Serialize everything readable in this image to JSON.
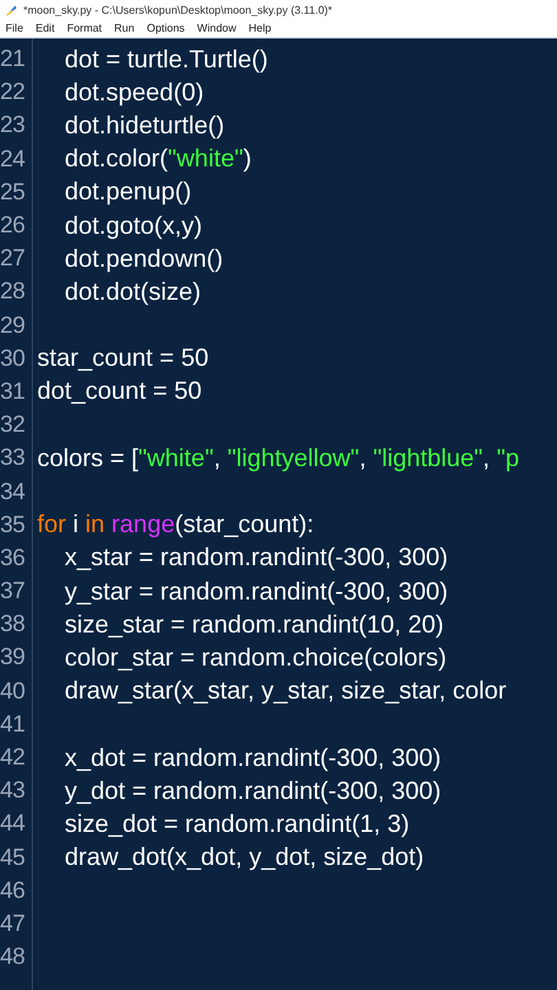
{
  "window": {
    "title": "*moon_sky.py - C:\\Users\\kopun\\Desktop\\moon_sky.py (3.11.0)*"
  },
  "menu": [
    {
      "label": "File"
    },
    {
      "label": "Edit"
    },
    {
      "label": "Format"
    },
    {
      "label": "Run"
    },
    {
      "label": "Options"
    },
    {
      "label": "Window"
    },
    {
      "label": "Help"
    }
  ],
  "editor": {
    "lines": [
      {
        "number": "21",
        "tokens": [
          {
            "kind": "plain",
            "text": "    dot = turtle.Turtle()"
          }
        ]
      },
      {
        "number": "22",
        "tokens": [
          {
            "kind": "plain",
            "text": "    dot.speed(0)"
          }
        ]
      },
      {
        "number": "23",
        "tokens": [
          {
            "kind": "plain",
            "text": "    dot.hideturtle()"
          }
        ]
      },
      {
        "number": "24",
        "tokens": [
          {
            "kind": "plain",
            "text": "    dot.color("
          },
          {
            "kind": "string",
            "text": "\"white\""
          },
          {
            "kind": "plain",
            "text": ")"
          }
        ]
      },
      {
        "number": "25",
        "tokens": [
          {
            "kind": "plain",
            "text": "    dot.penup()"
          }
        ]
      },
      {
        "number": "26",
        "tokens": [
          {
            "kind": "plain",
            "text": "    dot.goto(x,y)"
          }
        ]
      },
      {
        "number": "27",
        "tokens": [
          {
            "kind": "plain",
            "text": "    dot.pendown()"
          }
        ]
      },
      {
        "number": "28",
        "tokens": [
          {
            "kind": "plain",
            "text": "    dot.dot(size)"
          }
        ]
      },
      {
        "number": "29"
      },
      {
        "number": "30",
        "tokens": [
          {
            "kind": "plain",
            "text": "star_count = 50"
          }
        ]
      },
      {
        "number": "31",
        "tokens": [
          {
            "kind": "plain",
            "text": "dot_count = 50"
          }
        ]
      },
      {
        "number": "32"
      },
      {
        "number": "33",
        "tokens": [
          {
            "kind": "plain",
            "text": "colors = ["
          },
          {
            "kind": "string",
            "text": "\"white\""
          },
          {
            "kind": "plain",
            "text": ", "
          },
          {
            "kind": "string",
            "text": "\"lightyellow\""
          },
          {
            "kind": "plain",
            "text": ", "
          },
          {
            "kind": "string",
            "text": "\"lightblue\""
          },
          {
            "kind": "plain",
            "text": ", "
          },
          {
            "kind": "string",
            "text": "\"p"
          }
        ]
      },
      {
        "number": "34"
      },
      {
        "number": "35",
        "tokens": [
          {
            "kind": "keyword",
            "text": "for"
          },
          {
            "kind": "plain",
            "text": " i "
          },
          {
            "kind": "keyword",
            "text": "in "
          },
          {
            "kind": "builtin",
            "text": "range"
          },
          {
            "kind": "plain",
            "text": "(star_count):"
          }
        ]
      },
      {
        "number": "36",
        "tokens": [
          {
            "kind": "plain",
            "text": "    x_star = random.randint(-300, 300)"
          }
        ]
      },
      {
        "number": "37",
        "tokens": [
          {
            "kind": "plain",
            "text": "    y_star = random.randint(-300, 300)"
          }
        ]
      },
      {
        "number": "38",
        "tokens": [
          {
            "kind": "plain",
            "text": "    size_star = random.randint(10, 20)"
          }
        ]
      },
      {
        "number": "39",
        "tokens": [
          {
            "kind": "plain",
            "text": "    color_star = random.choice(colors)"
          }
        ]
      },
      {
        "number": "40",
        "tokens": [
          {
            "kind": "plain",
            "text": "    draw_star(x_star, y_star, size_star, color"
          }
        ]
      },
      {
        "number": "41"
      },
      {
        "number": "42",
        "tokens": [
          {
            "kind": "plain",
            "text": "    x_dot = random.randint(-300, 300)"
          }
        ]
      },
      {
        "number": "43",
        "tokens": [
          {
            "kind": "plain",
            "text": "    y_dot = random.randint(-300, 300)"
          }
        ]
      },
      {
        "number": "44",
        "tokens": [
          {
            "kind": "plain",
            "text": "    size_dot = random.randint(1, 3)"
          }
        ]
      },
      {
        "number": "45",
        "tokens": [
          {
            "kind": "plain",
            "text": "    draw_dot(x_dot, y_dot, size_dot)"
          }
        ]
      },
      {
        "number": "46"
      },
      {
        "number": "47"
      },
      {
        "number": "48"
      }
    ]
  }
}
